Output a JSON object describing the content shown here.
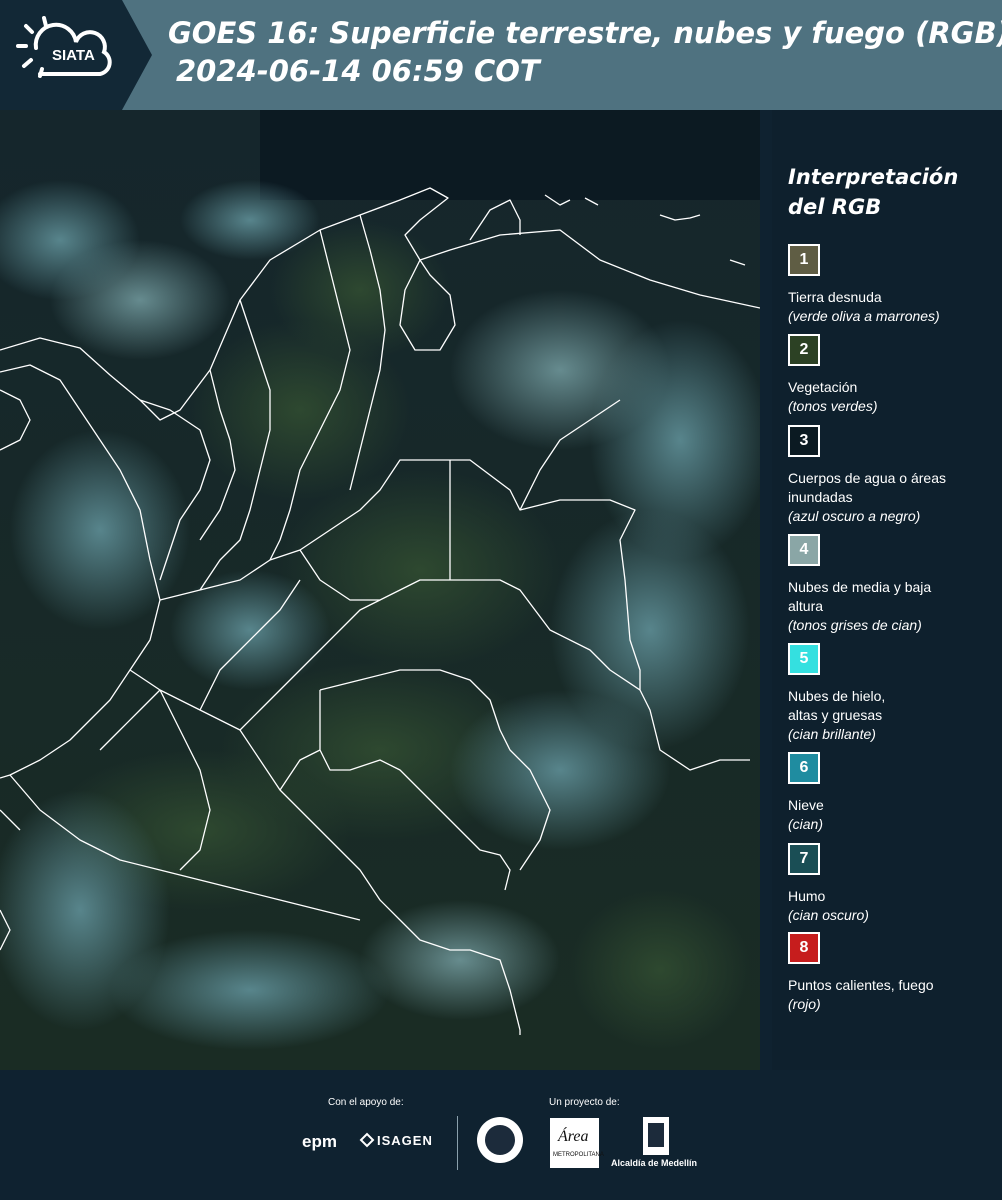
{
  "header": {
    "logo_text": "SIATA",
    "title_line1": "GOES 16: Superficie terrestre, nubes y fuego (RGB)",
    "title_line2": "2024-06-14 06:59 COT"
  },
  "legend": {
    "title_line1": "Interpretación",
    "title_line2": "del RGB",
    "items": [
      {
        "num": "1",
        "color": "#5f5d44",
        "label": "Tierra desnuda",
        "sub": "(verde oliva a marrones)"
      },
      {
        "num": "2",
        "color": "#2c4124",
        "label": "Vegetación",
        "sub": "(tonos verdes)"
      },
      {
        "num": "3",
        "color": "#0b1a22",
        "label": "Cuerpos de agua o áreas inundadas",
        "sub": "(azul oscuro a negro)"
      },
      {
        "num": "4",
        "color": "#8aa6a6",
        "label": "Nubes de media y baja altura",
        "sub": "(tonos grises de cian)"
      },
      {
        "num": "5",
        "color": "#34e0e0",
        "label": "Nubes de hielo, altas y gruesas",
        "sub": "(cian brillante)"
      },
      {
        "num": "6",
        "color": "#1f8ca0",
        "label": "Nieve",
        "sub": "(cian)"
      },
      {
        "num": "7",
        "color": "#1a4e55",
        "label": "Humo",
        "sub": "(cian oscuro)"
      },
      {
        "num": "8",
        "color": "#c61d1d",
        "label": "Puntos calientes, fuego",
        "sub": "(rojo)"
      }
    ]
  },
  "footer": {
    "support_label": "Con el apoyo de:",
    "project_label": "Un proyecto de:",
    "epm_text": "epm",
    "isagen_text": "ISAGEN",
    "area_text": "Área",
    "area_sub": "METROPOLITANA",
    "alcaldia_text": "Alcaldía de Medellín"
  }
}
